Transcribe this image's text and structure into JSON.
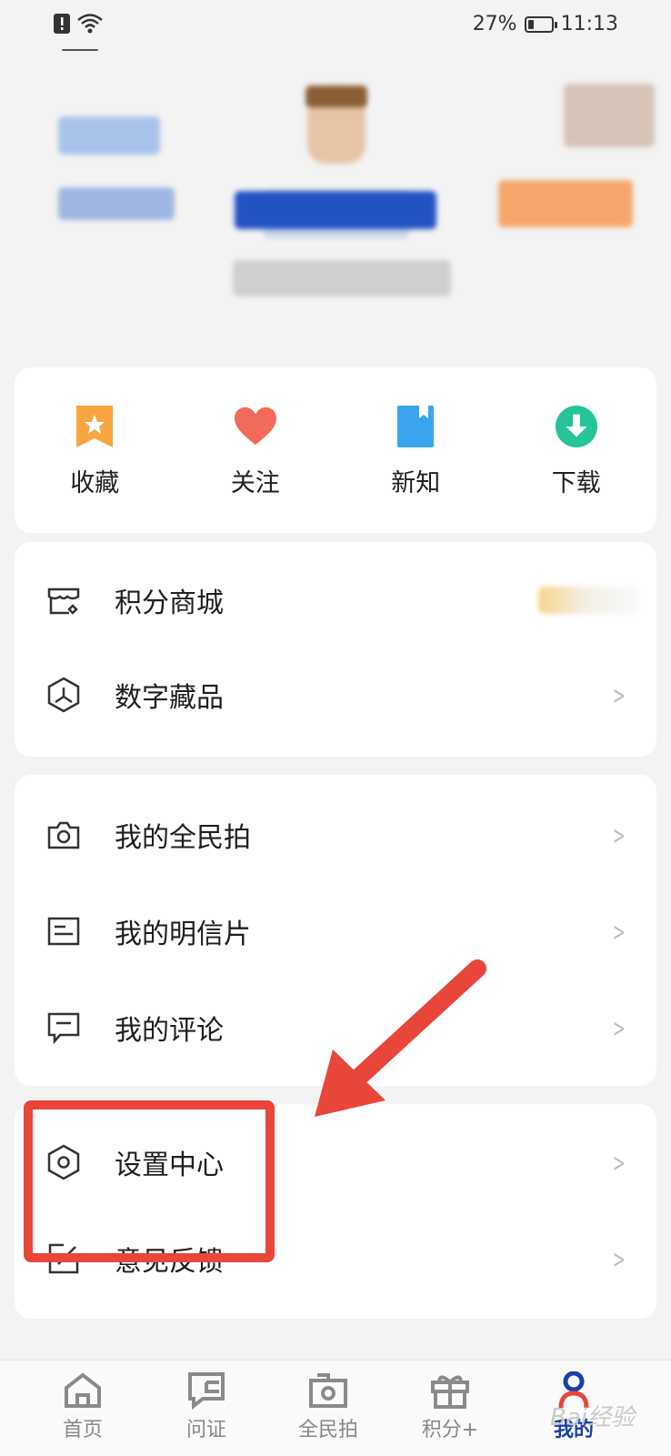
{
  "status": {
    "battery": "27%",
    "time": "11:13",
    "battery_level": 0.27
  },
  "quick_actions": [
    {
      "label": "收藏",
      "icon": "bookmark-star-icon"
    },
    {
      "label": "关注",
      "icon": "heart-icon"
    },
    {
      "label": "新知",
      "icon": "book-icon"
    },
    {
      "label": "下载",
      "icon": "download-icon"
    }
  ],
  "menu_group1": [
    {
      "label": "积分商城",
      "icon": "points-mall-icon"
    },
    {
      "label": "数字藏品",
      "icon": "digital-collectible-icon"
    }
  ],
  "menu_group2": [
    {
      "label": "我的全民拍",
      "icon": "camera-icon"
    },
    {
      "label": "我的明信片",
      "icon": "postcard-icon"
    },
    {
      "label": "我的评论",
      "icon": "comment-icon"
    }
  ],
  "menu_group3": [
    {
      "label": "设置中心",
      "icon": "settings-icon"
    },
    {
      "label": "意见反馈",
      "icon": "feedback-icon"
    }
  ],
  "tabs": [
    {
      "label": "首页",
      "icon": "home-icon"
    },
    {
      "label": "问证",
      "icon": "question-icon"
    },
    {
      "label": "全民拍",
      "icon": "photo-icon"
    },
    {
      "label": "积分+",
      "icon": "gift-icon"
    },
    {
      "label": "我的",
      "icon": "profile-icon",
      "active": true
    }
  ],
  "watermark": "Bai经验",
  "colors": {
    "accent": "#1b3fa8",
    "annotation": "#e8463a"
  }
}
